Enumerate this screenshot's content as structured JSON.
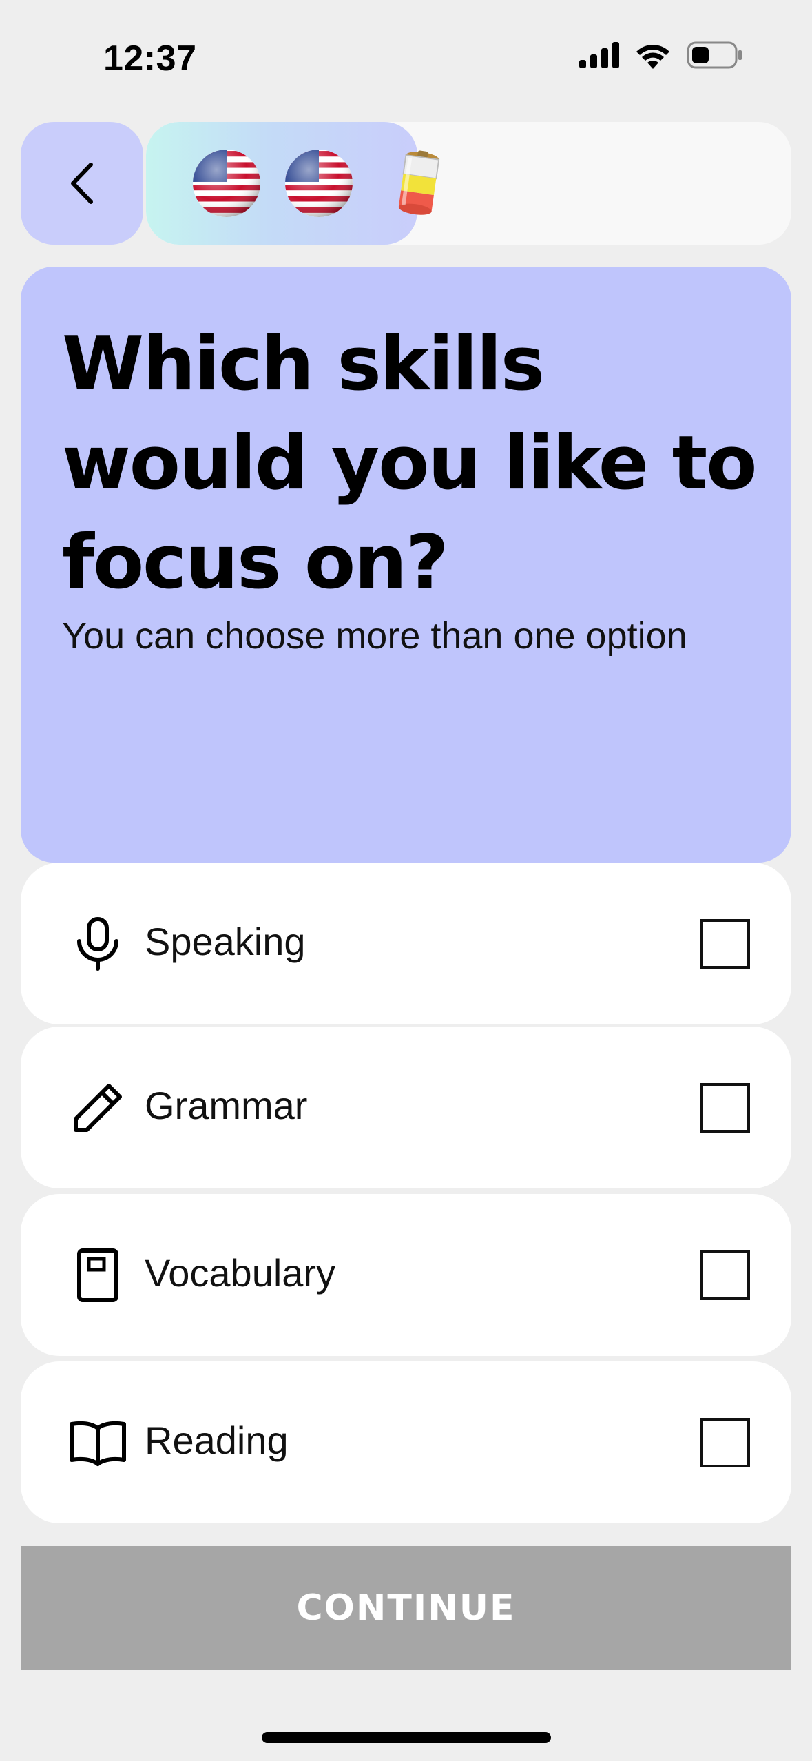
{
  "status_bar": {
    "time": "12:37",
    "icons": [
      "signal-icon",
      "wifi-icon",
      "battery-icon"
    ]
  },
  "nav": {
    "back_icon": "chevron-left-icon",
    "progress_fraction": 0.42,
    "progress_items": [
      "us-flag-globe-icon",
      "us-flag-globe-icon",
      "battery-can-icon"
    ]
  },
  "question": {
    "title": "Which skills would you like to focus on?",
    "subtitle": "You can choose more than one option"
  },
  "options": [
    {
      "label": "Speaking",
      "icon": "microphone-icon",
      "checked": false
    },
    {
      "label": "Grammar",
      "icon": "pencil-icon",
      "checked": false
    },
    {
      "label": "Vocabulary",
      "icon": "notebook-icon",
      "checked": false
    },
    {
      "label": "Reading",
      "icon": "open-book-icon",
      "checked": false
    }
  ],
  "continue": {
    "label": "CONTINUE",
    "enabled": false
  },
  "colors": {
    "background": "#eeeeee",
    "accent": "#bfc5fc",
    "back_button": "#c9cdfb",
    "continue_disabled": "#a6a6a6"
  }
}
